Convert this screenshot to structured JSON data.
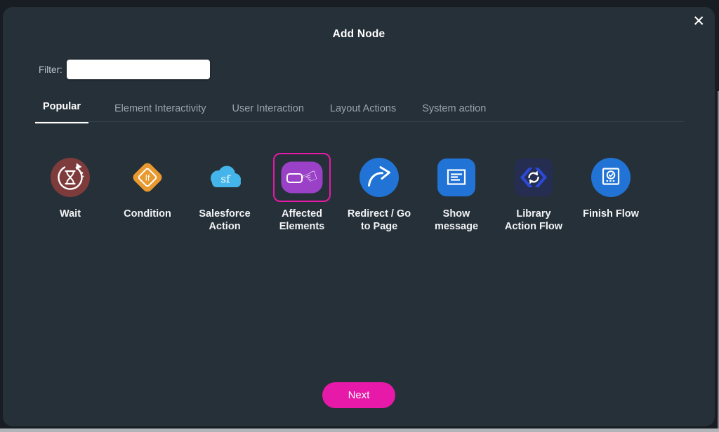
{
  "modal": {
    "title": "Add Node",
    "close_glyph": "✕"
  },
  "filter": {
    "label": "Filter:",
    "value": "",
    "placeholder": ""
  },
  "tabs": [
    {
      "label": "Popular",
      "active": true
    },
    {
      "label": "Element Interactivity",
      "active": false
    },
    {
      "label": "User Interaction",
      "active": false
    },
    {
      "label": "Layout Actions",
      "active": false
    },
    {
      "label": "System action",
      "active": false
    }
  ],
  "nodes": [
    {
      "label": "Wait",
      "icon": "wait-hourglass-icon",
      "shape": "circle",
      "color": "#7d3b3b",
      "selected": false
    },
    {
      "label": "Condition",
      "icon": "if-diamond-icon",
      "shape": "diamond",
      "color": "#e8992f",
      "selected": false,
      "icon_text": "If"
    },
    {
      "label": "Salesforce Action",
      "icon": "salesforce-cloud-icon",
      "shape": "cloud",
      "color": "#44b5ea",
      "selected": false,
      "icon_text": "sf"
    },
    {
      "label": "Affected Elements",
      "icon": "hand-toggle-icon",
      "shape": "rounded-rect",
      "color": "#9a41c7",
      "selected": true,
      "icon_glyph": "☜"
    },
    {
      "label": "Redirect / Go to Page",
      "icon": "redirect-arrow-icon",
      "shape": "circle",
      "color": "#2173d5",
      "selected": false
    },
    {
      "label": "Show message",
      "icon": "message-box-icon",
      "shape": "rounded-square",
      "color": "#2173d5",
      "selected": false
    },
    {
      "label": "Library Action Flow",
      "icon": "sync-hexagon-icon",
      "shape": "rounded-square",
      "color": "#252e50",
      "selected": false
    },
    {
      "label": "Finish Flow",
      "icon": "finish-check-icon",
      "shape": "circle",
      "color": "#2173d5",
      "selected": false
    }
  ],
  "footer": {
    "next_label": "Next"
  },
  "colors": {
    "modal_bg": "#263038",
    "outer_bg": "#171d23",
    "accent_pink": "#e619a8",
    "selection_border": "#e619a8",
    "node_blue": "#2173d5",
    "salesforce_blue": "#44b5ea",
    "condition_orange": "#e8992f",
    "wait_maroon": "#7d3b3b",
    "affected_purple": "#9a41c7",
    "library_navy": "#252e50",
    "library_chevron_blue": "#2b49d8",
    "tab_inactive_text": "#9aa4ab",
    "label_text": "#f2f4f6"
  }
}
